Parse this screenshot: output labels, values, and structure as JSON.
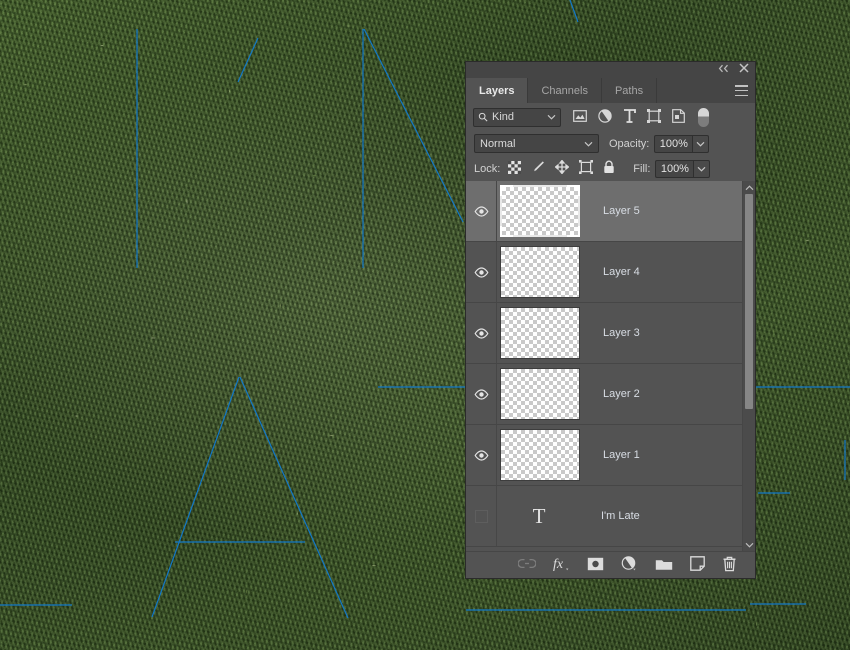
{
  "canvas": {
    "background": "grass-texture",
    "path_color": "#1278c8",
    "description": "Photoshop document canvas showing a grass photo with blue vector paths forming letter outlines"
  },
  "panel": {
    "title_controls": {
      "collapse_icon": "collapse-double-arrow-icon",
      "close_icon": "close-icon"
    },
    "menu_icon": "panel-menu-icon",
    "tabs": [
      {
        "label": "Layers",
        "active": true
      },
      {
        "label": "Channels",
        "active": false
      },
      {
        "label": "Paths",
        "active": false
      }
    ],
    "filter": {
      "search_icon": "search-icon",
      "kind_label": "Kind",
      "caret_icon": "chevron-down-icon",
      "type_filters": [
        {
          "name": "filter-pixel-layers-icon"
        },
        {
          "name": "filter-adjustment-layers-icon"
        },
        {
          "name": "filter-type-layers-icon"
        },
        {
          "name": "filter-shape-layers-icon"
        },
        {
          "name": "filter-smart-object-layers-icon"
        }
      ],
      "toggle_name": "filter-enable-toggle"
    },
    "blend": {
      "mode": "Normal",
      "opacity_label": "Opacity:",
      "opacity_value": "100%",
      "fill_label": "Fill:",
      "fill_value": "100%"
    },
    "lock": {
      "label": "Lock:",
      "icons": [
        {
          "name": "lock-transparent-pixels-icon"
        },
        {
          "name": "lock-image-pixels-icon"
        },
        {
          "name": "lock-position-icon"
        },
        {
          "name": "lock-artboard-nesting-icon"
        },
        {
          "name": "lock-all-icon"
        }
      ]
    },
    "layers": [
      {
        "name": "Layer 5",
        "visible": true,
        "selected": true,
        "kind": "pixel"
      },
      {
        "name": "Layer 4",
        "visible": true,
        "selected": false,
        "kind": "pixel"
      },
      {
        "name": "Layer 3",
        "visible": true,
        "selected": false,
        "kind": "pixel"
      },
      {
        "name": "Layer 2",
        "visible": true,
        "selected": false,
        "kind": "pixel"
      },
      {
        "name": "Layer 1",
        "visible": true,
        "selected": false,
        "kind": "pixel"
      },
      {
        "name": "I'm Late",
        "visible": false,
        "selected": false,
        "kind": "type"
      }
    ],
    "footer_buttons": [
      {
        "name": "link-layers-button"
      },
      {
        "name": "layer-style-fx-button"
      },
      {
        "name": "add-layer-mask-button"
      },
      {
        "name": "new-adjustment-layer-button"
      },
      {
        "name": "new-group-button"
      },
      {
        "name": "new-layer-button"
      },
      {
        "name": "delete-layer-button"
      }
    ],
    "scrollbar": {
      "up_icon": "chevron-up-icon",
      "down_icon": "chevron-down-icon"
    }
  },
  "colors": {
    "panel_bg": "#535353",
    "panel_header": "#454545",
    "selected_row": "#6e6e6e",
    "layer_text": "#d8dde4",
    "path_blue": "#1278c8"
  }
}
